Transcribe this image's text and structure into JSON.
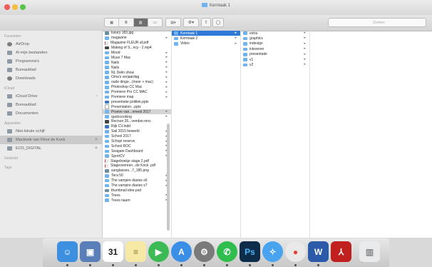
{
  "window": {
    "title": "Kerntaak 1",
    "search_placeholder": "Zoeken"
  },
  "toolbar": {
    "view_modes": [
      "icon-view-icon",
      "list-view-icon",
      "column-view-icon",
      "coverflow-view-icon"
    ],
    "active_view": 2
  },
  "sidebar": {
    "sections": [
      {
        "heading": "Favorieten",
        "items": [
          {
            "label": "AirDrop",
            "icon": "airdrop-icon"
          },
          {
            "label": "Al mijn bestanden",
            "icon": "all-files-icon"
          },
          {
            "label": "Programma's",
            "icon": "applications-icon"
          },
          {
            "label": "Bureaublad",
            "icon": "desktop-icon"
          },
          {
            "label": "Downloads",
            "icon": "downloads-icon"
          }
        ]
      },
      {
        "heading": "iCloud",
        "items": [
          {
            "label": "iCloud Drive",
            "icon": "icloud-icon",
            "badge": "◔"
          },
          {
            "label": "Bureaublad",
            "icon": "desktop-icon"
          },
          {
            "label": "Documenten",
            "icon": "documents-icon"
          }
        ]
      },
      {
        "heading": "Apparaten",
        "items": [
          {
            "label": "Niet-lokale schijf",
            "icon": "disk-icon"
          },
          {
            "label": "Macbook van Fleur de Kock",
            "icon": "laptop-icon",
            "eject": "≙",
            "selected": true
          },
          {
            "label": "EOS_DIGITAL",
            "icon": "disk-icon",
            "eject": "≙"
          }
        ]
      },
      {
        "heading": "Gedeeld",
        "items": []
      },
      {
        "heading": "Tags",
        "items": []
      }
    ]
  },
  "columns": {
    "col1": [
      {
        "label": "luxury 183.jpg",
        "type": "img"
      },
      {
        "label": "magazine",
        "type": "folder",
        "arrow": true
      },
      {
        "label": "Magazine FLEUR af.pdf",
        "type": "pdf"
      },
      {
        "label": "Making of S...ncy - 2.mp4",
        "type": "mov"
      },
      {
        "label": "Mood",
        "type": "folder",
        "arrow": true
      },
      {
        "label": "Muse 7 Mac",
        "type": "folder",
        "arrow": true
      },
      {
        "label": "Nails",
        "type": "folder",
        "arrow": true
      },
      {
        "label": "Nails",
        "type": "folder",
        "arrow": true
      },
      {
        "label": "NL Delin show",
        "type": "folder",
        "arrow": true
      },
      {
        "label": "Oma's verjaardag",
        "type": "folder",
        "arrow": true
      },
      {
        "label": "oude dinge...(moor + mac)",
        "type": "folder",
        "arrow": true
      },
      {
        "label": "Photoshop CC Mac",
        "type": "folder",
        "arrow": true
      },
      {
        "label": "Premiere Pro CC MAC",
        "type": "folder",
        "arrow": true
      },
      {
        "label": "Premiere map",
        "type": "folder",
        "arrow": true
      },
      {
        "label": "presentatie politiek.pptx",
        "type": "doc"
      },
      {
        "label": "Presentation...pptx",
        "type": "file"
      },
      {
        "label": "Proeve van...nmedi 2017",
        "type": "folder",
        "arrow": true,
        "selected": true
      },
      {
        "label": "quickcooking",
        "type": "folder",
        "arrow": true
      },
      {
        "label": "Recnon 26...vember.mov",
        "type": "mov"
      },
      {
        "label": "Rijk CV.indd",
        "type": "doc"
      },
      {
        "label": "Sail 2015 bewerkt",
        "type": "folder",
        "arrow": true
      },
      {
        "label": "School 2017",
        "type": "folder",
        "arrow": true
      },
      {
        "label": "Schopi reserve",
        "type": "folder",
        "arrow": true
      },
      {
        "label": "School ROC",
        "type": "folder",
        "arrow": true
      },
      {
        "label": "Seagate Dashboard",
        "type": "folder",
        "arrow": true
      },
      {
        "label": "SportCV",
        "type": "folder",
        "arrow": true
      },
      {
        "label": "Stageboekje stage 2.pdf",
        "type": "pdf"
      },
      {
        "label": "Stageovereen...de Kock .pdf",
        "type": "pdf"
      },
      {
        "label": "sunglasses...7_185.png",
        "type": "img"
      },
      {
        "label": "Tera 50",
        "type": "folder",
        "arrow": true
      },
      {
        "label": "The vampire diaries s6",
        "type": "folder",
        "arrow": true
      },
      {
        "label": "The vampire diaries s7",
        "type": "folder",
        "arrow": true
      },
      {
        "label": "thumbnail idee.psd",
        "type": "img"
      },
      {
        "label": "Trees",
        "type": "folder",
        "arrow": true
      },
      {
        "label": "Trees naam",
        "type": "folder",
        "arrow": true
      }
    ],
    "col2": [
      {
        "label": "Kerntaak 1",
        "type": "folder",
        "arrow": true,
        "selected": true
      },
      {
        "label": "Kerntaak 2",
        "type": "folder",
        "arrow": true
      },
      {
        "label": "Video",
        "type": "folder",
        "arrow": true
      }
    ],
    "col3": [
      {
        "label": "extra",
        "type": "folder",
        "arrow": true
      },
      {
        "label": "graphics",
        "type": "folder",
        "arrow": true
      },
      {
        "label": "indesign",
        "type": "folder",
        "arrow": true
      },
      {
        "label": "inleveren",
        "type": "folder",
        "arrow": true
      },
      {
        "label": "presentatie",
        "type": "folder",
        "arrow": true
      },
      {
        "label": "v1",
        "type": "folder",
        "arrow": true
      },
      {
        "label": "v2",
        "type": "folder",
        "arrow": true
      }
    ]
  },
  "dock": {
    "apps": [
      {
        "name": "finder-icon",
        "color": "#3d8fe0",
        "glyph": "☺"
      },
      {
        "name": "preview-icon",
        "color": "#5a7fb8",
        "glyph": "▣"
      },
      {
        "name": "calendar-icon",
        "color": "#ffffff",
        "glyph": "31",
        "text": "#222"
      },
      {
        "name": "notes-icon",
        "color": "#f5e9a5",
        "glyph": "≡",
        "text": "#8a7a30"
      },
      {
        "name": "facetime-icon",
        "color": "#3cba54",
        "glyph": "▶"
      },
      {
        "name": "app-store-icon",
        "color": "#3a8ee6",
        "glyph": "A"
      },
      {
        "name": "system-preferences-icon",
        "color": "#7a7a7a",
        "glyph": "⚙"
      },
      {
        "name": "whatsapp-icon",
        "color": "#2fbd4e",
        "glyph": "✆"
      },
      {
        "name": "photoshop-icon",
        "color": "#0c2c4a",
        "glyph": "Ps",
        "text": "#4cb4ff"
      },
      {
        "name": "safari-icon",
        "color": "#4aa3ef",
        "glyph": "✧"
      },
      {
        "name": "chrome-icon",
        "color": "#e9e9e9",
        "glyph": "●",
        "text": "#e94235"
      },
      {
        "name": "word-icon",
        "color": "#2b5aa8",
        "glyph": "W"
      },
      {
        "name": "acrobat-icon",
        "color": "#c0201e",
        "glyph": "⅄"
      },
      {
        "name": "trash-icon",
        "color": "#e8eaec",
        "glyph": "▥",
        "text": "#888"
      }
    ]
  }
}
